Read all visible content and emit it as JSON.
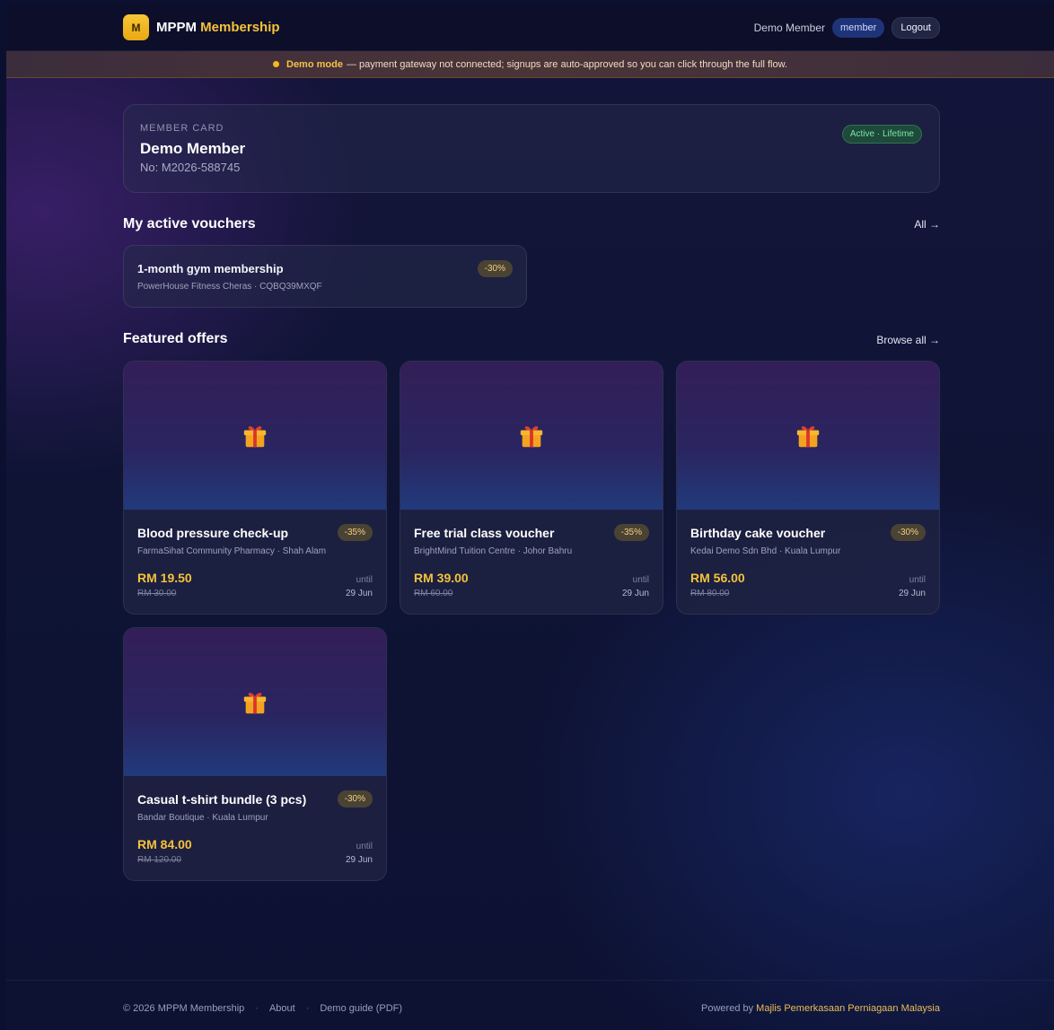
{
  "header": {
    "logo_letter": "M",
    "brand_main": "MPPM",
    "brand_accent": "Membership",
    "user_name": "Demo Member",
    "role": "member",
    "logout_label": "Logout"
  },
  "banner": {
    "strong": "Demo mode",
    "text": "— payment gateway not connected; signups are auto-approved so you can click through the full flow."
  },
  "member_card": {
    "label": "MEMBER CARD",
    "name": "Demo Member",
    "number": "No: M2026-588745",
    "status": "Active · Lifetime"
  },
  "vouchers": {
    "title": "My active vouchers",
    "link": "All →",
    "items": [
      {
        "title": "1-month gym membership",
        "subtitle": "PowerHouse Fitness Cheras · CQBQ39MXQF",
        "discount": "-30%"
      }
    ]
  },
  "offers": {
    "title": "Featured offers",
    "link": "Browse all →",
    "items": [
      {
        "title": "Blood pressure check-up",
        "subtitle": "FarmaSihat Community Pharmacy · Shah Alam",
        "discount": "-35%",
        "price": "RM 19.50",
        "old_price": "RM 30.00",
        "until_label": "until",
        "until_date": "29 Jun",
        "icon": "gift-icon"
      },
      {
        "title": "Free trial class voucher",
        "subtitle": "BrightMind Tuition Centre · Johor Bahru",
        "discount": "-35%",
        "price": "RM 39.00",
        "old_price": "RM 60.00",
        "until_label": "until",
        "until_date": "29 Jun",
        "icon": "gift-icon"
      },
      {
        "title": "Birthday cake voucher",
        "subtitle": "Kedai Demo Sdn Bhd · Kuala Lumpur",
        "discount": "-30%",
        "price": "RM 56.00",
        "old_price": "RM 80.00",
        "until_label": "until",
        "until_date": "29 Jun",
        "icon": "gift-icon"
      },
      {
        "title": "Casual t-shirt bundle (3 pcs)",
        "subtitle": "Bandar Boutique · Kuala Lumpur",
        "discount": "-30%",
        "price": "RM 84.00",
        "old_price": "RM 120.00",
        "until_label": "until",
        "until_date": "29 Jun",
        "icon": "gift-icon"
      }
    ]
  },
  "footer": {
    "copyright": "© 2026 MPPM Membership",
    "about": "About",
    "guide": "Demo guide (PDF)",
    "powered_by": "Powered by",
    "org": "Majlis Pemerkasaan Perniagaan Malaysia"
  },
  "colors": {
    "accent": "#f5c23a",
    "active_status": "#7de6a5",
    "role_badge": "#1f3478"
  }
}
